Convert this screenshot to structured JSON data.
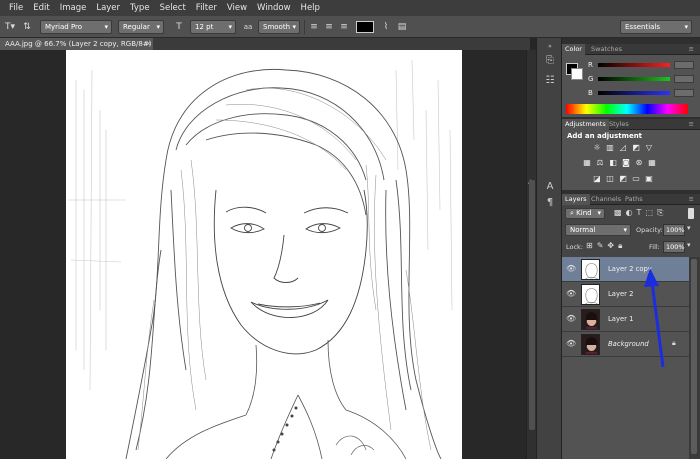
{
  "menu": [
    "File",
    "Edit",
    "Image",
    "Layer",
    "Type",
    "Select",
    "Filter",
    "View",
    "Window",
    "Help"
  ],
  "options": {
    "font_family": "Myriad Pro",
    "font_style": "Regular",
    "font_size": "12 pt",
    "antialias_glyph": "aa",
    "antialias": "Smooth",
    "workspace": "Essentials"
  },
  "document": {
    "tab_title": "AAA.jpg @ 66.7% (Layer 2 copy, RGB/8#) *",
    "close": "×"
  },
  "color_panel": {
    "tabs": [
      "Color",
      "Swatches"
    ],
    "channels": [
      {
        "label": "R",
        "color": "#ff2020"
      },
      {
        "label": "G",
        "color": "#20c020"
      },
      {
        "label": "B",
        "color": "#3030ff"
      }
    ]
  },
  "adjustments_panel": {
    "tabs": [
      "Adjustments",
      "Styles"
    ],
    "heading": "Add an adjustment"
  },
  "layers_panel": {
    "tabs": [
      "Layers",
      "Channels",
      "Paths"
    ],
    "filter": "Kind",
    "blend_mode": "Normal",
    "opacity_label": "Opacity:",
    "opacity": "100%",
    "lock_label": "Lock:",
    "fill_label": "Fill:",
    "fill": "100%",
    "layers": [
      {
        "name": "Layer 2 copy",
        "selected": true,
        "type": "sketch"
      },
      {
        "name": "Layer 2",
        "selected": false,
        "type": "sketch"
      },
      {
        "name": "Layer 1",
        "selected": false,
        "type": "photo"
      },
      {
        "name": "Background",
        "selected": false,
        "type": "photo",
        "locked": true
      }
    ]
  },
  "annotation_arrow_color": "#1a2ee0"
}
